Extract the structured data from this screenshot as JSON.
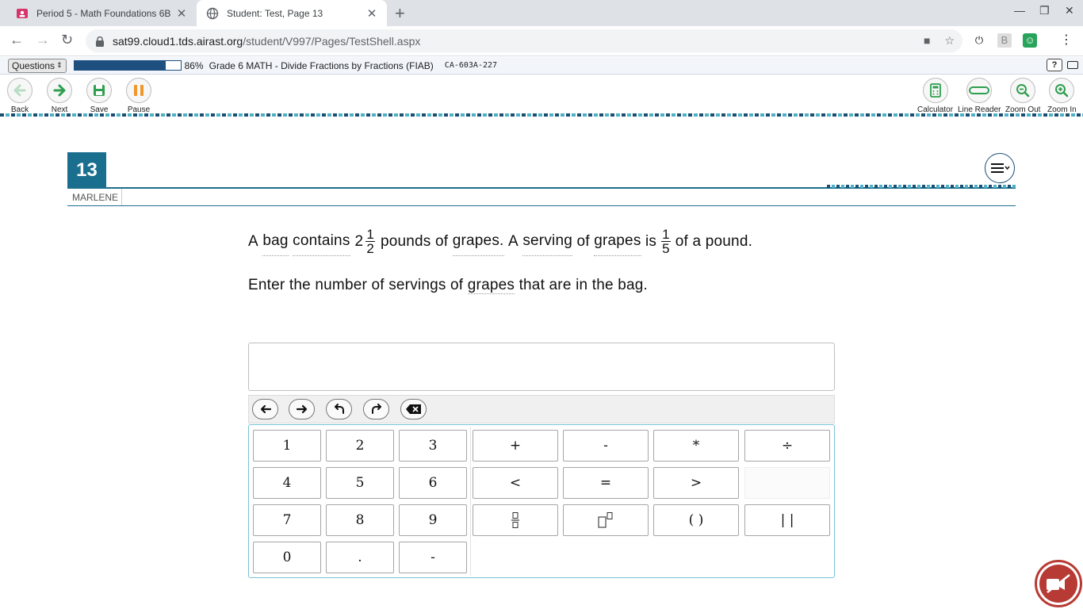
{
  "browser": {
    "tabs": [
      {
        "title": "Period 5 - Math Foundations 6B",
        "active": false
      },
      {
        "title": "Student: Test, Page 13",
        "active": true
      }
    ],
    "url_host": "sat99.cloud1.tds.airast.org",
    "url_path": "/student/V997/Pages/TestShell.aspx"
  },
  "infobar": {
    "questions_label": "Questions",
    "progress_percent": 86,
    "progress_text": "86%",
    "test_name": "Grade 6 MATH - Divide Fractions by Fractions (FIAB)",
    "test_code": "CA-603A-227",
    "help_label": "?"
  },
  "toolbar": {
    "back": "Back",
    "next": "Next",
    "save": "Save",
    "pause": "Pause",
    "calculator": "Calculator",
    "line_reader": "Line Reader",
    "zoom_out": "Zoom Out",
    "zoom_in": "Zoom In"
  },
  "question": {
    "number": "13",
    "student_name": "MARLENE",
    "stem_part1": "A",
    "stem_bag": "bag",
    "stem_contains": "contains",
    "mixed_whole": "2",
    "mixed_num": "1",
    "mixed_den": "2",
    "stem_pounds_of": "pounds of",
    "stem_grapes": "grapes.",
    "stem_a": "A",
    "stem_serving": "serving",
    "stem_of": "of",
    "stem_grapes2": "grapes",
    "stem_is": "is",
    "frac_num": "1",
    "frac_den": "5",
    "stem_end": "of a pound.",
    "prompt_1": "Enter the number of servings of",
    "prompt_grapes": "grapes",
    "prompt_2": "that are in the bag."
  },
  "keypad": {
    "numbers": [
      "1",
      "2",
      "3",
      "4",
      "5",
      "6",
      "7",
      "8",
      "9",
      "0",
      ".",
      "-"
    ],
    "ops": [
      "+",
      "-",
      "*",
      "÷",
      "<",
      "=",
      ">",
      "( )",
      "| |"
    ]
  },
  "colors": {
    "accent": "#1b6f8e",
    "progress": "#1d4f7f",
    "next_green": "#2e9e4f",
    "pause_orange": "#f0962a",
    "record_red": "#b83a34"
  }
}
